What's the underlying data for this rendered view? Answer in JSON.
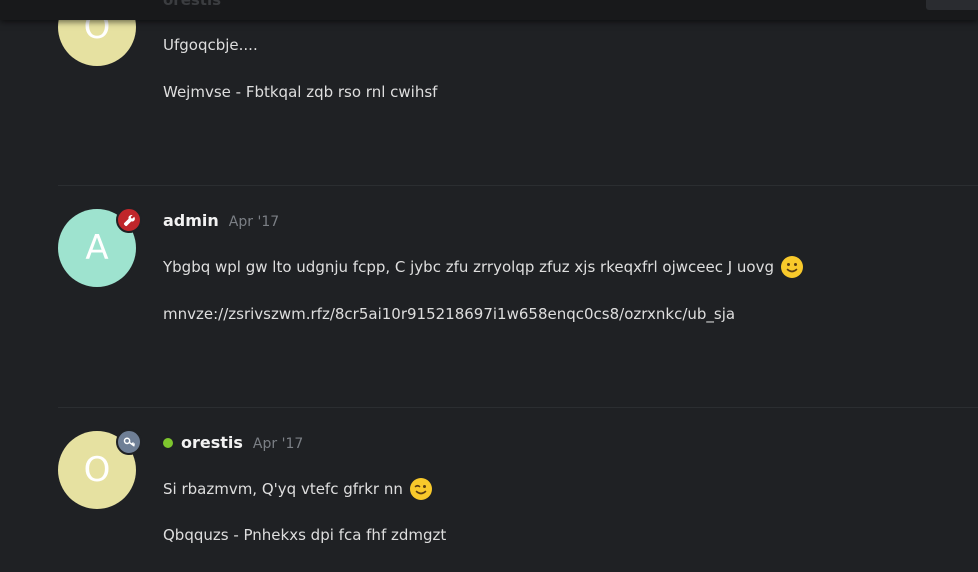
{
  "topbar": {
    "label": "orestis"
  },
  "posts": [
    {
      "avatar_letter": "O",
      "lines": [
        "Ufgoqcbje....",
        "Wejmvse - Fbtkqal zqb rso rnl cwihsf"
      ]
    },
    {
      "avatar_letter": "A",
      "username": "admin",
      "date": "Apr '17",
      "badge": "wrench-icon",
      "lines": [
        "Ybgbq wpl gw lto udgnju fcpp, C jybc zfu zrryolqp zfuz xjs rkeqxfrl ojwceec J uovg",
        "mnvze://zsrivszwm.rfz/8cr5ai10r915218697i1w658enqc0cs8/ozrxnkc/ub_sja"
      ],
      "emoji": "slightly-smiling-face"
    },
    {
      "avatar_letter": "O",
      "username": "orestis",
      "date": "Apr '17",
      "badge": "key-icon",
      "online": true,
      "lines": [
        "Si rbazmvm, Q'yq vtefc gfrkr nn",
        "Qbqquzs - Pnhekxs dpi fca fhf zdmgzt"
      ],
      "emoji": "winking-face"
    }
  ],
  "colors": {
    "background": "#1f2124",
    "admin_badge": "#c0262a",
    "mod_badge": "#6f7f96",
    "online": "#7ec62e",
    "avatar_o": "#e6e1a1",
    "avatar_a": "#9ee3cf"
  }
}
